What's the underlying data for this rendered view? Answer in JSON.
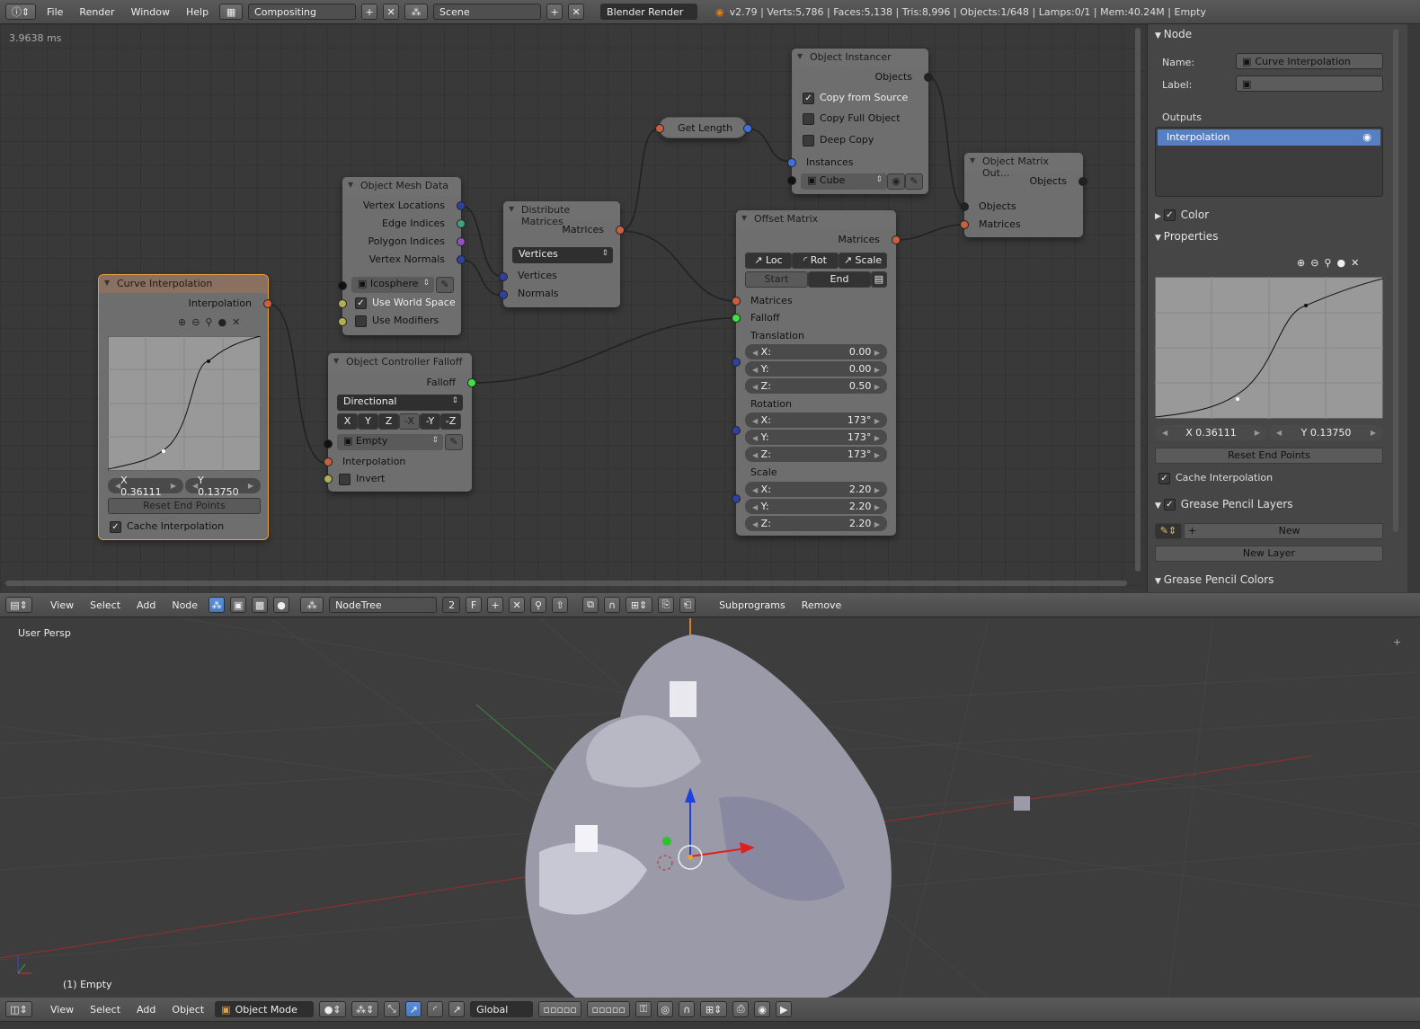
{
  "top_header": {
    "menus": [
      "File",
      "Render",
      "Window",
      "Help"
    ],
    "screen_layout": "Compositing",
    "scene": "Scene",
    "render_engine": "Blender Render",
    "stats": "v2.79 | Verts:5,786 | Faces:5,138 | Tris:8,996 | Objects:1/648 | Lamps:0/1 | Mem:40.24M | Empty"
  },
  "node_editor": {
    "timing": "3.9638 ms",
    "header": {
      "menus": [
        "View",
        "Select",
        "Add",
        "Node"
      ],
      "tree_name": "NodeTree",
      "users": "2",
      "fake": "F",
      "buttons": [
        "Subprograms",
        "Remove"
      ]
    },
    "nodes": {
      "curve_interp": {
        "title": "Curve Interpolation",
        "output": "Interpolation",
        "x": "X 0.36111",
        "y": "Y 0.13750",
        "reset": "Reset End Points",
        "cache": "Cache Interpolation"
      },
      "mesh_data": {
        "title": "Object Mesh Data",
        "outs": [
          "Vertex Locations",
          "Edge Indices",
          "Polygon Indices",
          "Vertex Normals"
        ],
        "object": "Icosphere",
        "world": "Use World Space",
        "mods": "Use Modifiers"
      },
      "distribute": {
        "title": "Distribute Matrices",
        "out": "Matrices",
        "mode": "Vertices",
        "ins": [
          "Vertices",
          "Normals"
        ]
      },
      "get_length": {
        "title": "Get Length"
      },
      "instancer": {
        "title": "Object Instancer",
        "out": "Objects",
        "opts": [
          "Copy from Source",
          "Copy Full Object",
          "Deep Copy"
        ],
        "instances": "Instances",
        "object": "Cube"
      },
      "matrix_out": {
        "title": "Object Matrix Out...",
        "out": "Objects",
        "ins": [
          "Objects",
          "Matrices"
        ]
      },
      "falloff": {
        "title": "Object Controller Falloff",
        "out": "Falloff",
        "mode": "Directional",
        "axes": [
          "X",
          "Y",
          "Z",
          "-X",
          "-Y",
          "-Z"
        ],
        "object": "Empty",
        "ins": [
          "Interpolation",
          "Invert"
        ]
      },
      "offset": {
        "title": "Offset Matrix",
        "out": "Matrices",
        "tabs": [
          "Loc",
          "Rot",
          "Scale"
        ],
        "modes": [
          "Start",
          "End"
        ],
        "ins": [
          "Matrices",
          "Falloff"
        ],
        "translation": "Translation",
        "t": [
          "0.00",
          "0.00",
          "0.50"
        ],
        "rotation": "Rotation",
        "r": [
          "173°",
          "173°",
          "173°"
        ],
        "scale": "Scale",
        "s": [
          "2.20",
          "2.20",
          "2.20"
        ],
        "axes": [
          "X:",
          "Y:",
          "Z:"
        ]
      }
    }
  },
  "side_panel": {
    "node_title": "Node",
    "name_label": "Name:",
    "name_value": "Curve Interpolation",
    "label_label": "Label:",
    "outputs_title": "Outputs",
    "output_item": "Interpolation",
    "color_title": "Color",
    "props_title": "Properties",
    "x": "X 0.36111",
    "y": "Y 0.13750",
    "reset": "Reset End Points",
    "cache": "Cache Interpolation",
    "gp_layers": "Grease Pencil Layers",
    "new": "New",
    "new_layer": "New Layer",
    "gp_colors": "Grease Pencil Colors"
  },
  "viewport": {
    "label": "User Persp",
    "active": "(1) Empty",
    "header": {
      "menus": [
        "View",
        "Select",
        "Add",
        "Object"
      ],
      "mode": "Object Mode",
      "orientation": "Global"
    }
  }
}
